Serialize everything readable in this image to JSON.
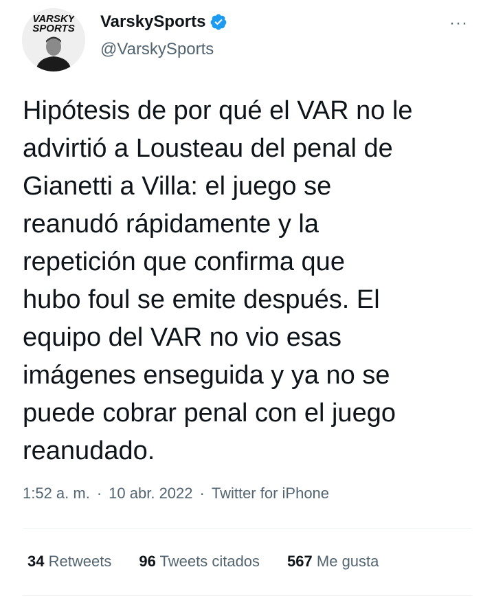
{
  "user": {
    "display_name": "VarskySports",
    "handle": "@VarskySports",
    "avatar_logo_line1": "VARSKY",
    "avatar_logo_line2": "SPORTS",
    "verified_color": "#1d9bf0"
  },
  "more_icon": "more-horizontal-icon",
  "more_label": "···",
  "tweet_text": "Hipótesis de por qué el VAR no le\nadvirtió a Lousteau del penal de\nGianetti a Villa: el juego se\nreanudó rápidamente y la\nrepetición que confirma que\nhubo foul se emite después. El\nequipo del VAR no vio esas\nimágenes enseguida y ya no se\npuede cobrar penal con el juego\nreanudado.",
  "meta": {
    "time": "1:52 a. m.",
    "sep1": "·",
    "date": "10 abr. 2022",
    "sep2": "·",
    "source": "Twitter for iPhone"
  },
  "stats": {
    "retweets_count": "34",
    "retweets_label": "Retweets",
    "quotes_count": "96",
    "quotes_label": "Tweets citados",
    "likes_count": "567",
    "likes_label": "Me gusta"
  }
}
